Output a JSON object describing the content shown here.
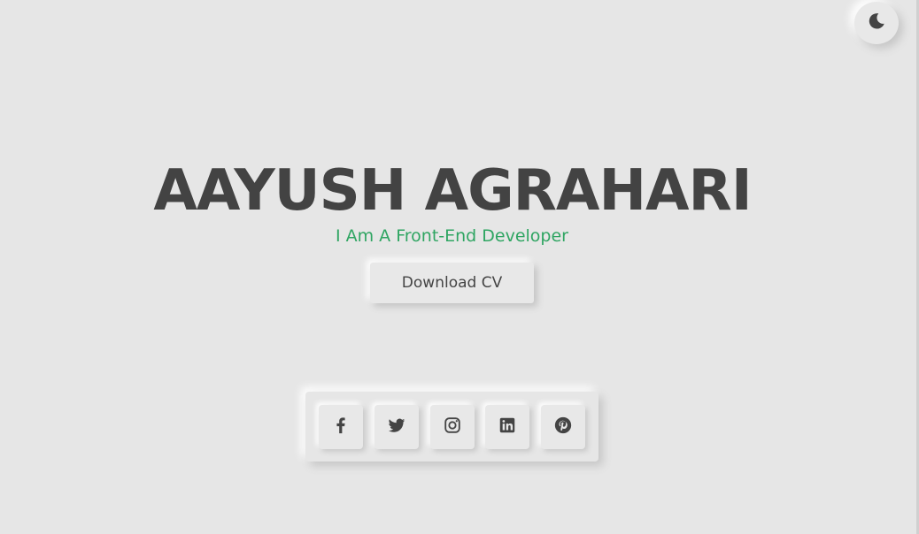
{
  "hero": {
    "name": "AAYUSH AGRAHARI",
    "subtitle": "I Am A Front-End Developer",
    "download_label": "Download CV"
  },
  "theme_toggle": {
    "icon": "moon-icon"
  },
  "social": {
    "items": [
      {
        "icon": "facebook-icon"
      },
      {
        "icon": "twitter-icon"
      },
      {
        "icon": "instagram-icon"
      },
      {
        "icon": "linkedin-icon"
      },
      {
        "icon": "pinterest-icon"
      }
    ]
  },
  "colors": {
    "background": "#e6e6e6",
    "heading": "#434343",
    "accent": "#2fa562"
  }
}
